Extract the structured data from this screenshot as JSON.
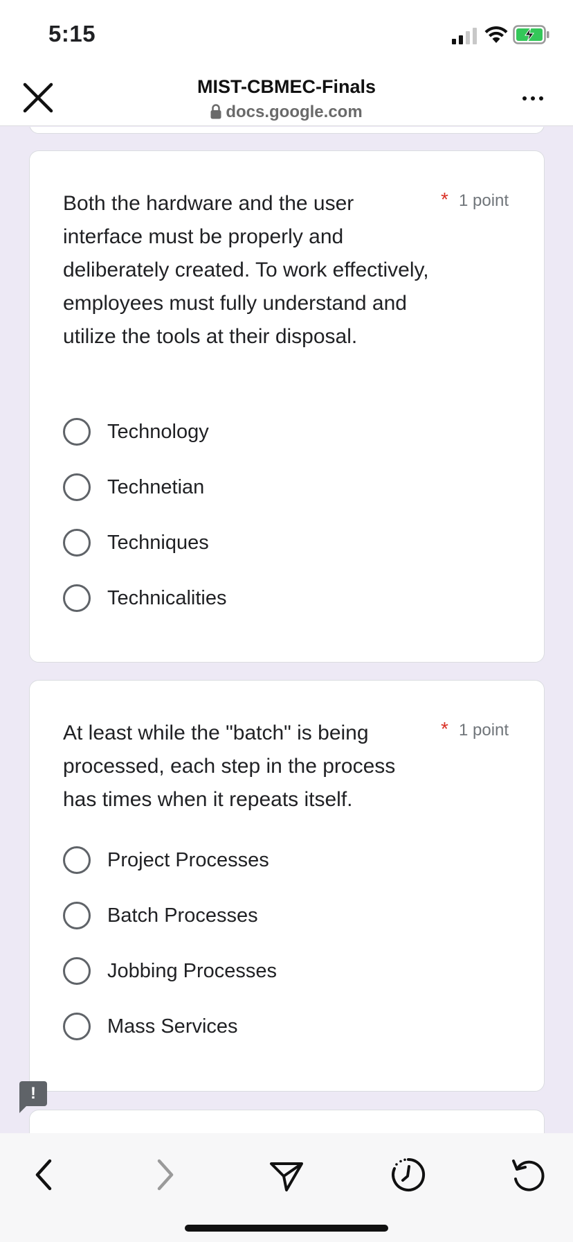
{
  "status_bar": {
    "time": "5:15"
  },
  "browser": {
    "title": "MIST-CBMEC-Finals",
    "url": "docs.google.com"
  },
  "questions": [
    {
      "text": "Both the hardware and the user interface must be properly and deliberately created. To work effectively, employees must fully understand and utilize the tools at their disposal.",
      "required_mark": "*",
      "points": "1 point",
      "options": [
        "Technology",
        "Technetian",
        "Techniques",
        "Technicalities"
      ]
    },
    {
      "text": "At least while the \"batch\" is being processed, each step in the process has times when it repeats itself.",
      "required_mark": "*",
      "points": "1 point",
      "options": [
        "Project Processes",
        "Batch Processes",
        "Jobbing Processes",
        "Mass Services"
      ]
    }
  ],
  "feedback_icon": "!",
  "toolbar": {
    "icons": [
      "back-icon",
      "forward-icon",
      "share-icon",
      "history-icon",
      "reload-icon"
    ]
  }
}
